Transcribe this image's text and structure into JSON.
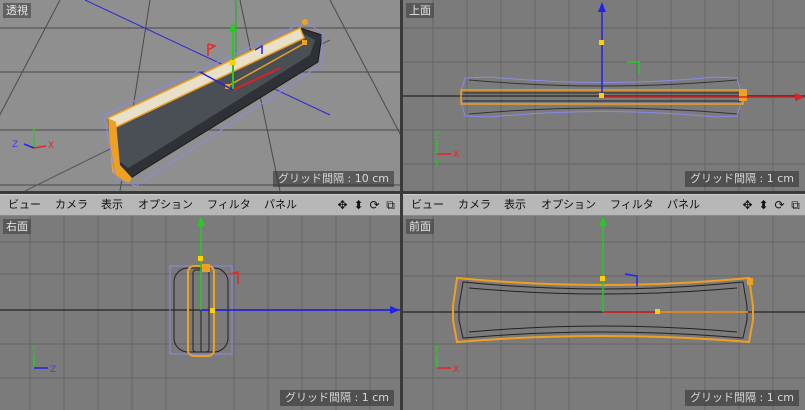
{
  "viewports": {
    "perspective": {
      "label": "透視",
      "grid_spacing": "グリッド間隔 : 10 cm"
    },
    "top": {
      "label": "上面",
      "grid_spacing": "グリッド間隔 : 1 cm"
    },
    "right": {
      "label": "右面",
      "grid_spacing": "グリッド間隔 : 1 cm"
    },
    "front": {
      "label": "前面",
      "grid_spacing": "グリッド間隔 : 1 cm"
    }
  },
  "menu": {
    "view": "ビュー",
    "camera": "カメラ",
    "display": "表示",
    "options": "オプション",
    "filter": "フィルタ",
    "panel": "パネル"
  },
  "nav_icons": [
    "move-view-icon",
    "dolly-view-icon",
    "rotate-view-icon",
    "toggle-layout-icon"
  ],
  "axis_labels": {
    "x": "X",
    "y": "Y",
    "z": "Z"
  },
  "colors": {
    "viewport_bg": "#7b7b7b",
    "persp_bg": "#8f8f8f",
    "menubar_bg": "#b7b7b7",
    "axis_x": "#e02020",
    "axis_y": "#22c022",
    "axis_z": "#2020e0",
    "selection": "#f0a020"
  }
}
